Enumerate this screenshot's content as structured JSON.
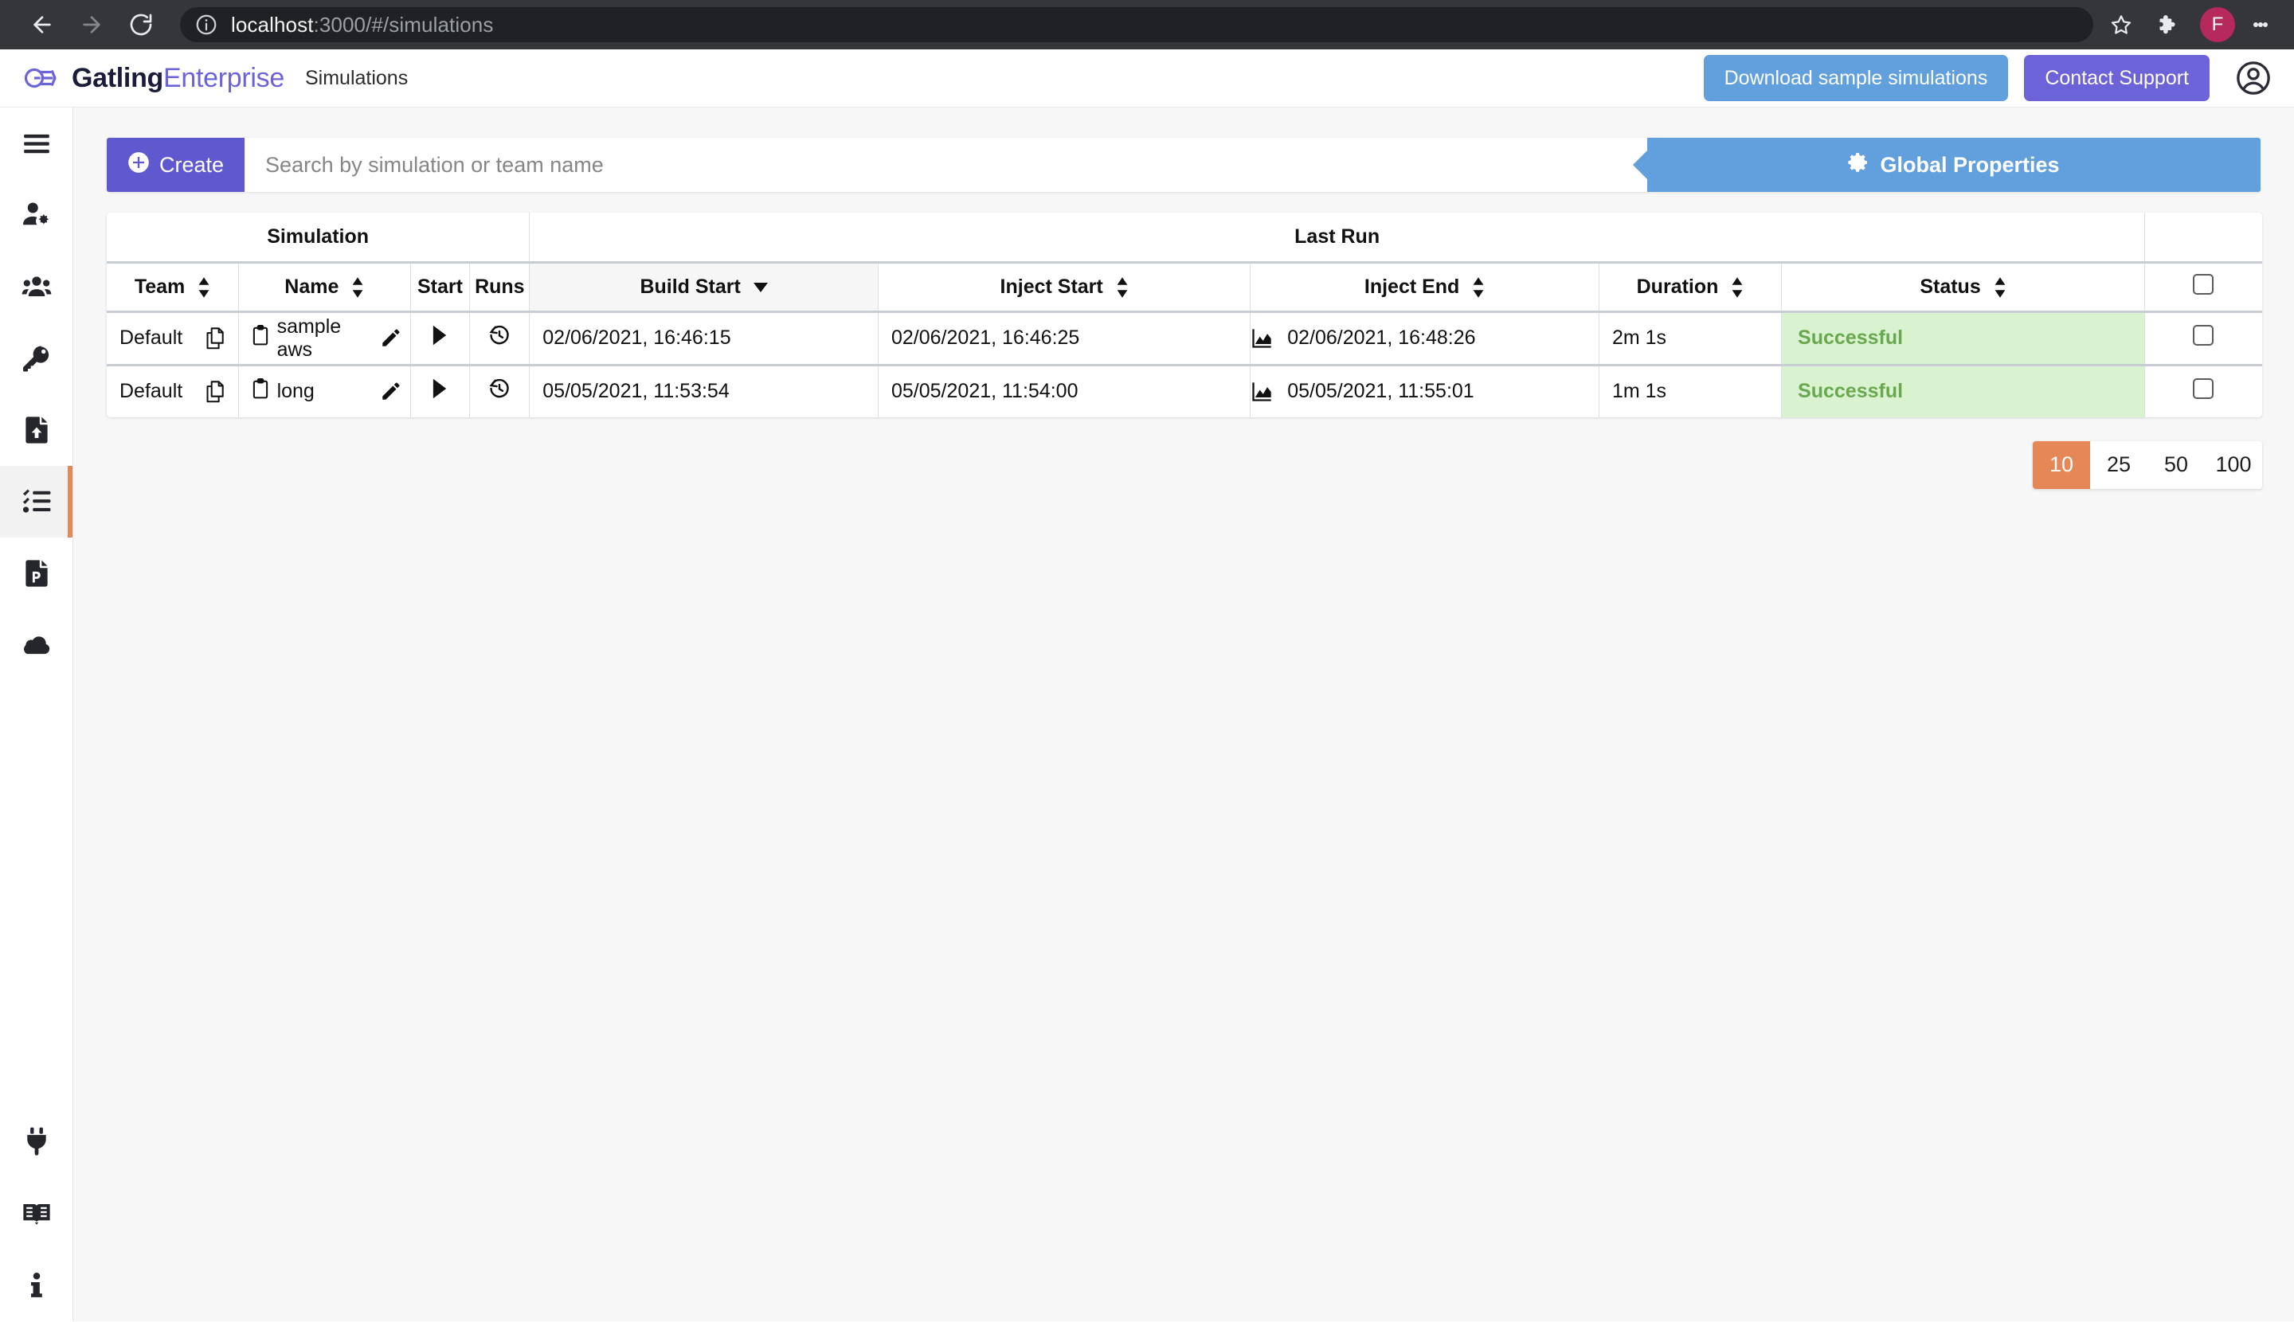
{
  "browser": {
    "back_icon": "arrow-left-icon",
    "forward_icon": "arrow-right-icon",
    "reload_icon": "reload-icon",
    "site_info_icon": "info-circle-icon",
    "url_host": "localhost",
    "url_path": ":3000/#/simulations",
    "bookmark_icon": "star-icon",
    "extensions_icon": "puzzle-icon",
    "profile_initial": "F",
    "profile_color": "#b5295c",
    "menu_icon": "kebab-menu-icon"
  },
  "header": {
    "logo_icon": "gatling-logo-icon",
    "brand_primary": "Gatling",
    "brand_secondary": "Enterprise",
    "page_title": "Simulations",
    "download_label": "Download sample simulations",
    "download_color": "#62a0dd",
    "support_label": "Contact Support",
    "support_color": "#6c63d8",
    "account_icon": "user-circle-icon"
  },
  "sidebar": {
    "active_accent": "#e58757",
    "items": [
      {
        "icon": "hamburger-menu-icon",
        "name": "sidebar-item-menu",
        "active": false
      },
      {
        "icon": "user-gear-icon",
        "name": "sidebar-item-user-settings",
        "active": false
      },
      {
        "icon": "users-icon",
        "name": "sidebar-item-teams",
        "active": false
      },
      {
        "icon": "key-icon",
        "name": "sidebar-item-api-tokens",
        "active": false
      },
      {
        "icon": "file-upload-icon",
        "name": "sidebar-item-packages",
        "active": false
      },
      {
        "icon": "tasks-list-icon",
        "name": "sidebar-item-simulations",
        "active": true
      },
      {
        "icon": "file-p-icon",
        "name": "sidebar-item-pools",
        "active": false
      },
      {
        "icon": "cloud-icon",
        "name": "sidebar-item-cloud",
        "active": false
      }
    ],
    "bottom_items": [
      {
        "icon": "plug-icon",
        "name": "sidebar-item-plugins"
      },
      {
        "icon": "book-icon",
        "name": "sidebar-item-documentation"
      },
      {
        "icon": "info-icon",
        "name": "sidebar-item-about"
      }
    ]
  },
  "toolbar": {
    "create_label": "Create",
    "create_icon": "plus-circle-icon",
    "create_color": "#6058cf",
    "search_placeholder": "Search by simulation or team name",
    "search_value": "",
    "global_properties_label": "Global Properties",
    "global_properties_icon": "gear-icon",
    "global_properties_color": "#62a0dd"
  },
  "table": {
    "group_headers": [
      {
        "label": "Simulation",
        "span": 4
      },
      {
        "label": "Last Run",
        "span": 5
      },
      {
        "label": "",
        "span": 1
      }
    ],
    "columns": [
      {
        "label": "Team",
        "sort": "both"
      },
      {
        "label": "Name",
        "sort": "both"
      },
      {
        "label": "Start",
        "sort": "none"
      },
      {
        "label": "Runs",
        "sort": "none"
      },
      {
        "label": "Build Start",
        "sort": "desc"
      },
      {
        "label": "Inject Start",
        "sort": "both"
      },
      {
        "label": "Inject End",
        "sort": "both"
      },
      {
        "label": "Duration",
        "sort": "both"
      },
      {
        "label": "Status",
        "sort": "both"
      },
      {
        "label": "",
        "sort": "none"
      }
    ],
    "select_all_checkbox": false,
    "status_bg": "#d9f2d0",
    "status_fg": "#6aa84f",
    "rows": [
      {
        "team": "Default",
        "copy_icon": "copy-icon",
        "name_icon": "clipboard-icon",
        "name": "sample aws",
        "edit_icon": "pencil-icon",
        "start_icon": "play-icon",
        "runs_icon": "history-icon",
        "build_start": "02/06/2021, 16:46:15",
        "inject_start": "02/06/2021, 16:46:25",
        "report_icon": "area-chart-icon",
        "inject_end": "02/06/2021, 16:48:26",
        "duration": "2m 1s",
        "status": "Successful",
        "selected": false
      },
      {
        "team": "Default",
        "copy_icon": "copy-icon",
        "name_icon": "clipboard-icon",
        "name": "long",
        "edit_icon": "pencil-icon",
        "start_icon": "play-icon",
        "runs_icon": "history-icon",
        "build_start": "05/05/2021, 11:53:54",
        "inject_start": "05/05/2021, 11:54:00",
        "report_icon": "area-chart-icon",
        "inject_end": "05/05/2021, 11:55:01",
        "duration": "1m 1s",
        "status": "Successful",
        "selected": false
      }
    ]
  },
  "pagination": {
    "options": [
      "10",
      "25",
      "50",
      "100"
    ],
    "selected": "10",
    "active_color": "#e58757"
  }
}
